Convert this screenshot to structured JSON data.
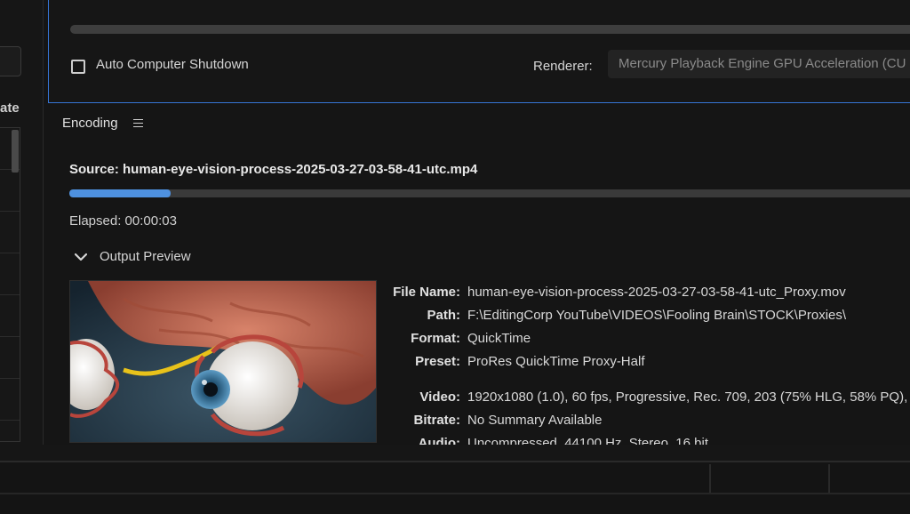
{
  "left_panel": {
    "label": "ate"
  },
  "top_panel": {
    "auto_shutdown_label": "Auto Computer Shutdown",
    "auto_shutdown_checked": false,
    "renderer_label": "Renderer:",
    "renderer_value": "Mercury Playback Engine GPU Acceleration (CU"
  },
  "encoding": {
    "header": "Encoding",
    "source_line": "Source: human-eye-vision-process-2025-03-27-03-58-41-utc.mp4",
    "progress_fraction": 0.12,
    "elapsed": "Elapsed: 00:00:03",
    "output_preview_label": "Output Preview",
    "info": [
      {
        "key": "File Name:",
        "value": "human-eye-vision-process-2025-03-27-03-58-41-utc_Proxy.mov"
      },
      {
        "key": "Path:",
        "value": "F:\\EditingCorp YouTube\\VIDEOS\\Fooling Brain\\STOCK\\Proxies\\"
      },
      {
        "key": "Format:",
        "value": "QuickTime"
      },
      {
        "key": "Preset:",
        "value": "ProRes QuickTime Proxy-Half"
      },
      {
        "key": "Video:",
        "value": "1920x1080 (1.0), 60 fps, Progressive, Rec. 709, 203 (75% HLG, 58% PQ), ("
      },
      {
        "key": "Bitrate:",
        "value": "No Summary Available"
      },
      {
        "key": "Audio:",
        "value": "Uncompressed, 44100 Hz, Stereo, 16 bit"
      }
    ]
  },
  "colors": {
    "accent": "#3574d4",
    "progress": "#4e91e0",
    "background": "#151515"
  }
}
